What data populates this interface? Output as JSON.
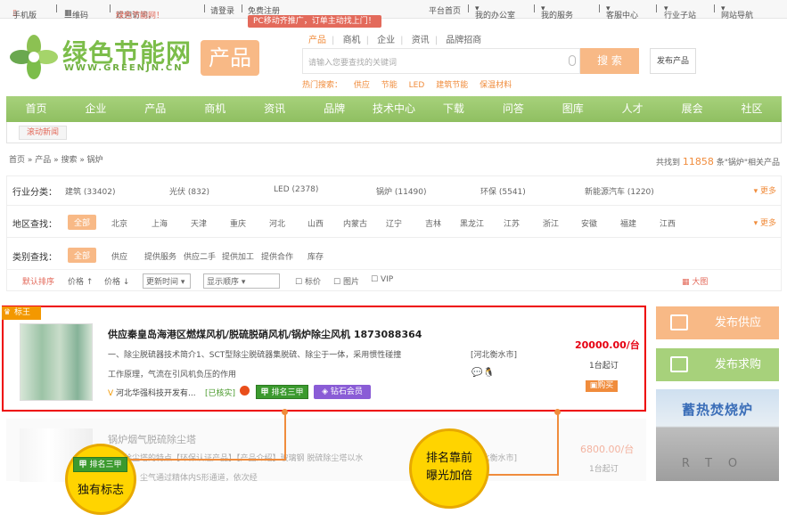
{
  "topbar": {
    "mobile": "手机版",
    "qrcode": "二维码",
    "welcome_prefix": "欢迎访问，",
    "welcome_site": "绿色节能网！",
    "login": "请登录",
    "register": "免费注册",
    "home": "平台首页",
    "office": "我的办公室",
    "service": "我的服务",
    "customer": "客服中心",
    "industry": "行业子站",
    "sitemap": "网站导航"
  },
  "promo": "PC移动齐推广，订单主动找上门！",
  "logo": {
    "name": "绿色节能网",
    "url": "WWW.GREENJN.CN",
    "channel": "产品"
  },
  "search": {
    "tabs": [
      "产品",
      "商机",
      "企业",
      "资讯",
      "品牌招商"
    ],
    "placeholder": "请输入您要查找的关键词",
    "button": "搜 索",
    "publish": "发布产品",
    "hot_label": "热门搜索：",
    "hot": [
      "供应",
      "节能",
      "LED",
      "建筑节能",
      "保温材料"
    ]
  },
  "nav": [
    "首页",
    "企业",
    "产品",
    "商机",
    "资讯",
    "品牌",
    "技术中心",
    "下载",
    "问答",
    "图库",
    "人才",
    "展会",
    "社区"
  ],
  "scroll_news": "滚动新闻",
  "breadcrumb": "首页 » 产品 » 搜索 » 锅炉",
  "found": {
    "prefix": "共找到 ",
    "count": "11858",
    "suffix": " 条\"锅炉\"相关产品"
  },
  "filters": {
    "industry": {
      "label": "行业分类：",
      "items": [
        "建筑 (33402)",
        "光伏 (832)",
        "LED (2378)",
        "锅炉 (11490)",
        "环保 (5541)",
        "新能源汽车 (1220)"
      ],
      "more": "更多"
    },
    "region": {
      "label": "地区查找：",
      "all": "全部",
      "items": [
        "北京",
        "上海",
        "天津",
        "重庆",
        "河北",
        "山西",
        "内蒙古",
        "辽宁",
        "吉林",
        "黑龙江",
        "江苏",
        "浙江",
        "安徽",
        "福建",
        "江西"
      ],
      "more": "更多"
    },
    "type": {
      "label": "类别查找：",
      "all": "全部",
      "items": [
        "供应",
        "提供服务",
        "供应二手",
        "提供加工",
        "提供合作",
        "库存"
      ]
    }
  },
  "sortbar": {
    "default": "默认排序",
    "price_up": "价格 ↑",
    "price_down": "价格 ↓",
    "time": "更新时间",
    "display": "显示顺序",
    "checks": [
      "标价",
      "图片",
      "VIP"
    ],
    "view": "大图"
  },
  "listing1": {
    "crown": "标王",
    "title": "供应秦皇岛海港区燃煤风机/脱硫脱硝风机/锅炉除尘风机 1873088364",
    "desc1": "一、除尘脱硫器技术简介1、SCT型除尘脱硫器集脱硫、除尘于一体，采用惯性碰撞",
    "desc2": "工作原理，气流在引风机负压的作用",
    "location": "[河北衡水市]",
    "price": "20000.00/台",
    "moq": "1台起订",
    "buy": "购买",
    "company": "河北华强科技开发有...",
    "verified": "[已核实]",
    "rank_badge": "排名三甲",
    "vip_badge": "钻石会员"
  },
  "listing2": {
    "title": "锅炉烟气脱硫除尘塔",
    "desc1": "脱硫除尘塔的特点【环保认证产品】【产品介绍】玻璃钢 脱硫除尘塔以水",
    "desc2": "力介质，尘气通过精体内S形通道，依次经",
    "location": "[河北衡水市]",
    "price": "6800.00/台",
    "moq": "1台起订"
  },
  "side": {
    "supply": "发布供应",
    "buy": "发布求购",
    "ad_title": "蓄热焚烧炉",
    "ad_letters": "RTO"
  },
  "callouts": {
    "badge": "排名三甲",
    "unique": "独有标志",
    "rank_line1": "排名靠前",
    "rank_line2": "曝光加倍"
  },
  "colors": {
    "accent": "#f08c3c",
    "green": "#8fbf61",
    "highlight_border": "#e00000",
    "callout": "#ffd400"
  }
}
